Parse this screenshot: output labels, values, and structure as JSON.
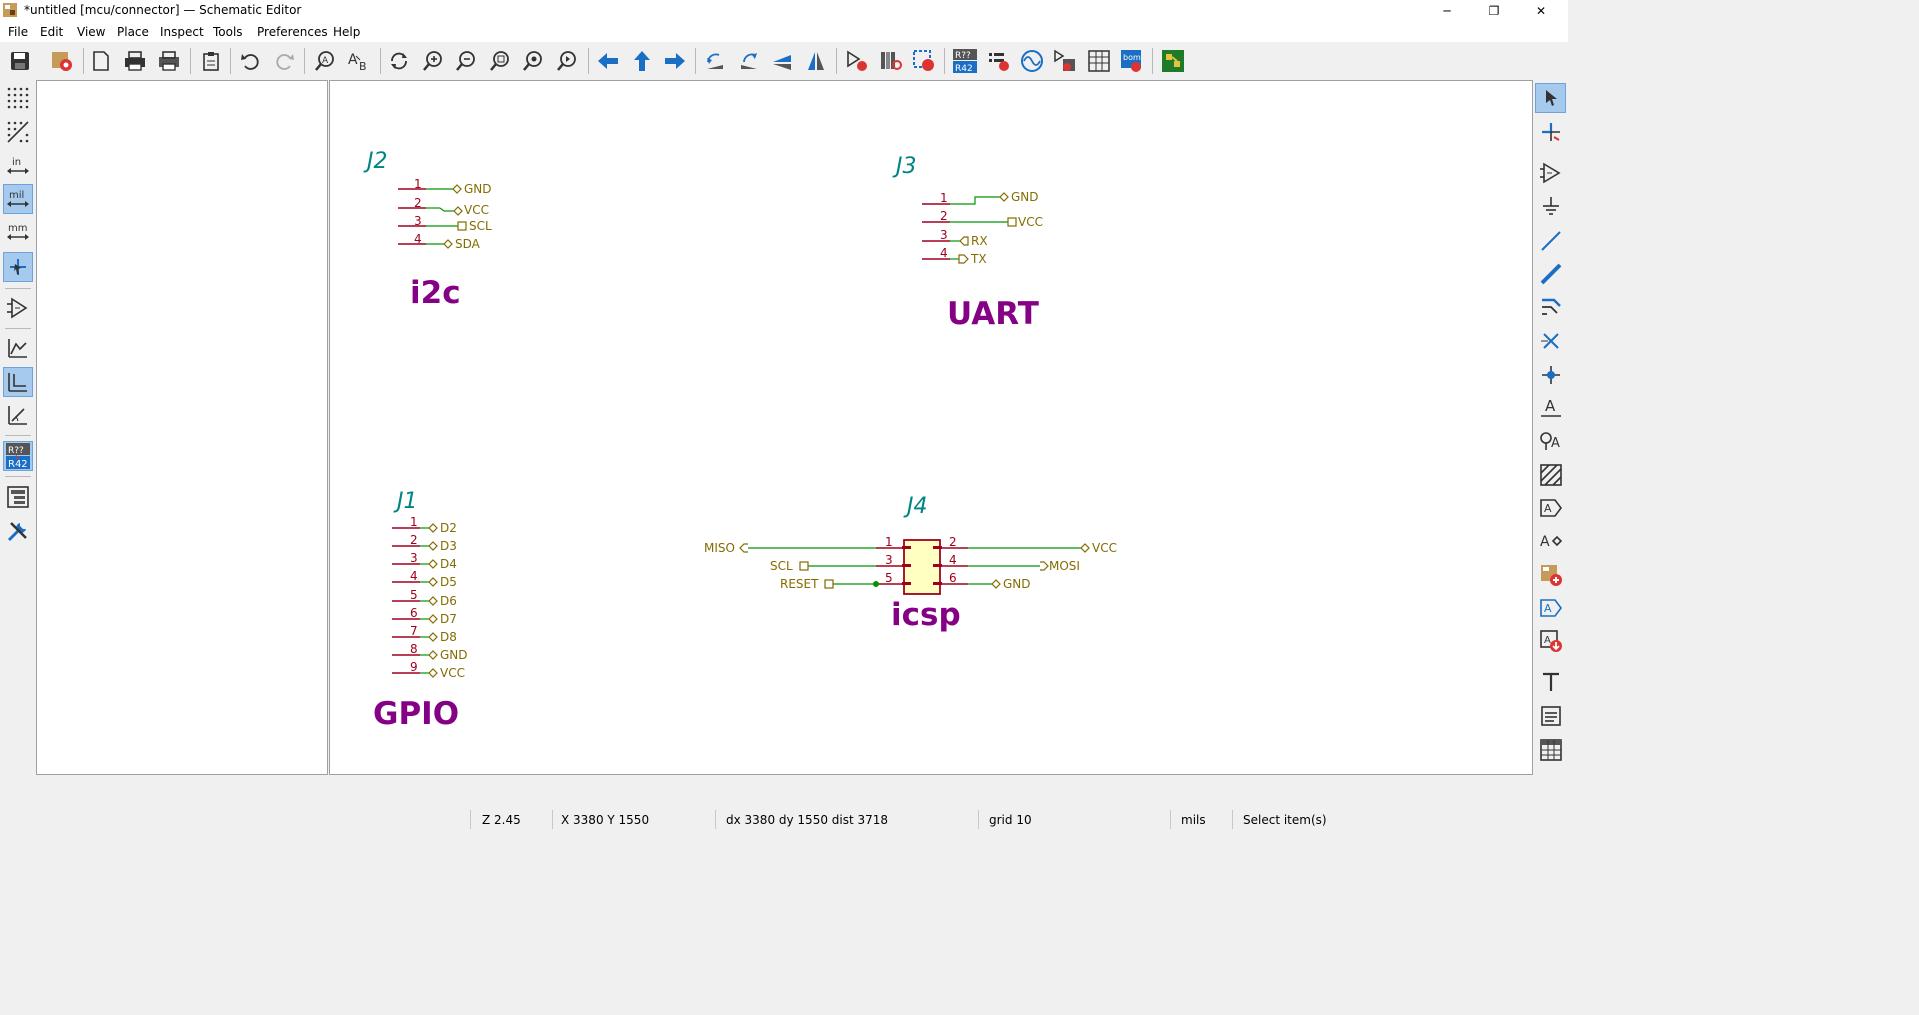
{
  "window": {
    "title": "*untitled [mcu/connector] — Schematic Editor",
    "controls": {
      "minimize": "─",
      "maximize": "❐",
      "close": "✕"
    }
  },
  "menu": [
    "File",
    "Edit",
    "View",
    "Place",
    "Inspect",
    "Tools",
    "Preferences",
    "Help"
  ],
  "toolbar": {
    "icons": [
      "save-icon",
      "schematic-setup-icon",
      "page-settings-icon",
      "print-icon",
      "plot-icon",
      "paste-icon",
      "undo-icon",
      "redo-icon",
      "find-icon",
      "find-replace-icon",
      "refresh-icon",
      "zoom-in-icon",
      "zoom-out-icon",
      "zoom-fit-icon",
      "zoom-objects-icon",
      "zoom-selection-icon",
      "navigate-back-icon",
      "navigate-up-icon",
      "navigate-forward-icon",
      "rotate-ccw-icon",
      "rotate-cw-icon",
      "mirror-vertical-icon",
      "mirror-horizontal-icon",
      "symbol-editor-icon",
      "symbol-browser-icon",
      "update-pcb-icon",
      "annotate-icon",
      "erc-icon",
      "simulator-icon",
      "assign-footprints-icon",
      "field-table-icon",
      "bom-icon",
      "pcb-editor-icon"
    ]
  },
  "left_toolbar": {
    "units": {
      "in": "in",
      "mil": "mil",
      "mm": "mm"
    },
    "annotate_top": "R??",
    "annotate_bottom": "R42"
  },
  "colors": {
    "pin": "#a0001e",
    "wire": "#009600",
    "label": "#846c00",
    "refdes": "#008484",
    "text": "#840084",
    "body_fill": "#ffffc2",
    "active_tool": "#a6c9ee"
  },
  "schematic": {
    "j2": {
      "ref": "J2",
      "note": "i2c",
      "pins": [
        "1",
        "2",
        "3",
        "4"
      ],
      "labels": [
        "GND",
        "VCC",
        "SCL",
        "SDA"
      ]
    },
    "j3": {
      "ref": "J3",
      "note": "UART",
      "pins": [
        "1",
        "2",
        "3",
        "4"
      ],
      "labels": [
        "GND",
        "VCC",
        "RX",
        "TX"
      ]
    },
    "j1": {
      "ref": "J1",
      "note": "GPIO",
      "pins": [
        "1",
        "2",
        "3",
        "4",
        "5",
        "6",
        "7",
        "8",
        "9"
      ],
      "labels": [
        "D2",
        "D3",
        "D4",
        "D5",
        "D6",
        "D7",
        "D8",
        "GND",
        "VCC"
      ]
    },
    "j4": {
      "ref": "J4",
      "note": "icsp",
      "left_pins": [
        "1",
        "3",
        "5"
      ],
      "right_pins": [
        "2",
        "4",
        "6"
      ],
      "left_labels": [
        "MISO",
        "SCL",
        "RESET"
      ],
      "right_labels": [
        "VCC",
        "MOSI",
        "GND"
      ]
    }
  },
  "status": {
    "zoom": "Z 2.45",
    "cursor": "X 3380  Y 1550",
    "delta": "dx 3380  dy 1550  dist 3718",
    "grid": "grid 10",
    "units": "mils",
    "message": "Select item(s)"
  }
}
